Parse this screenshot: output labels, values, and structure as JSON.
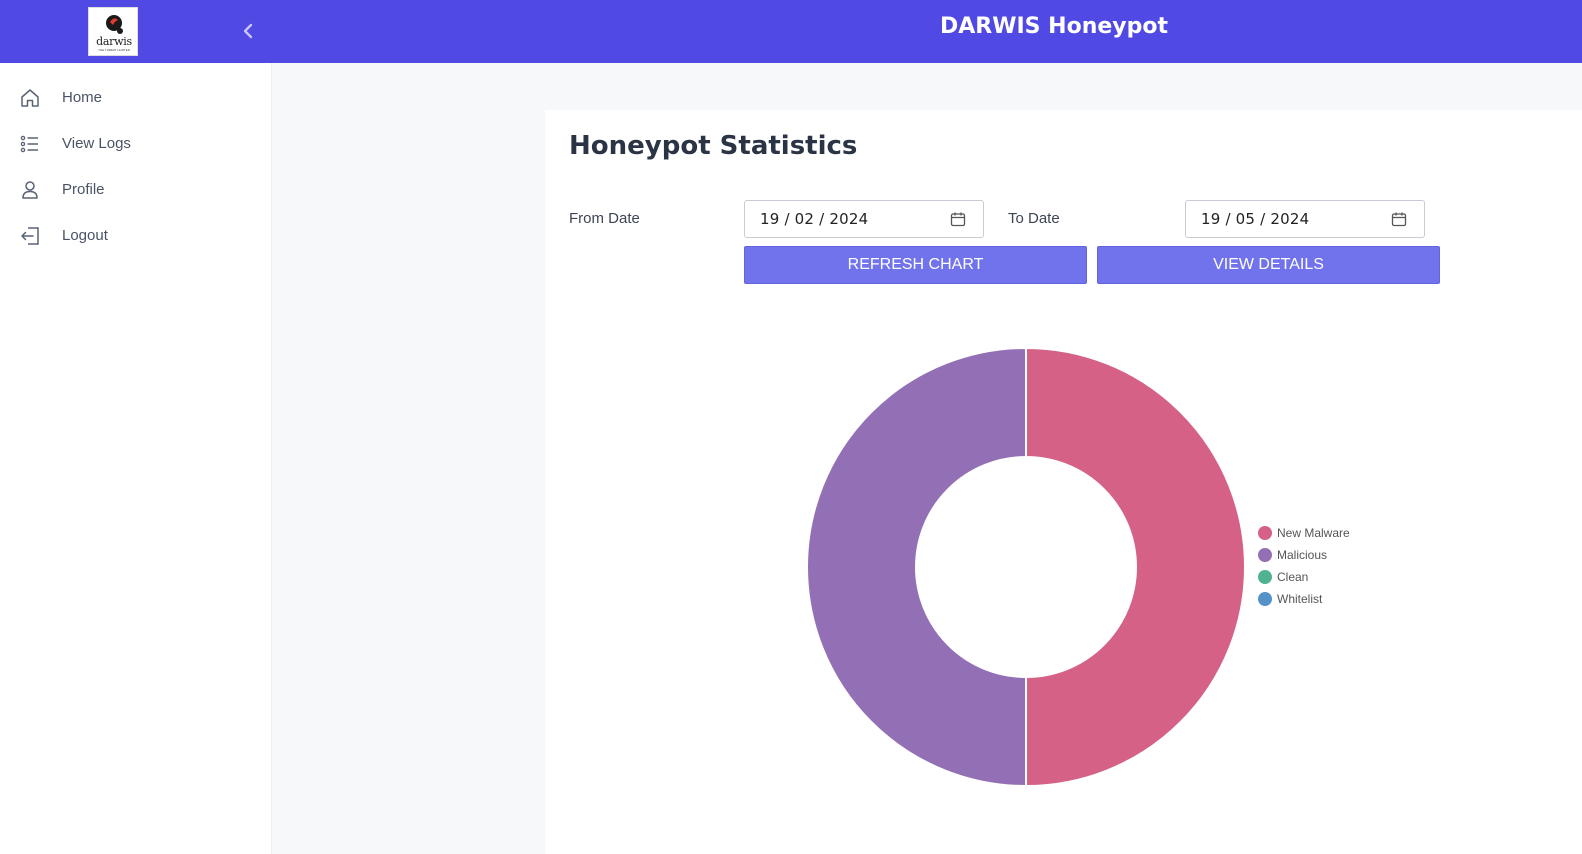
{
  "header": {
    "logo_text": "darwis",
    "logo_subtext": "THE THREAT HUNTER",
    "title": "DARWIS Honeypot",
    "brand_color": "#5149e4"
  },
  "sidebar": {
    "items": [
      {
        "label": "Home",
        "icon": "home-icon"
      },
      {
        "label": "View Logs",
        "icon": "list-icon"
      },
      {
        "label": "Profile",
        "icon": "user-icon"
      },
      {
        "label": "Logout",
        "icon": "logout-icon"
      }
    ]
  },
  "main": {
    "title": "Honeypot Statistics",
    "from_date_label": "From Date",
    "from_date_value": "19 / 02 / 2024",
    "to_date_label": "To Date",
    "to_date_value": "19 / 05 / 2024",
    "refresh_button": "REFRESH CHART",
    "details_button": "VIEW DETAILS"
  },
  "chart_data": {
    "type": "doughnut",
    "categories": [
      "New Malware",
      "Malicious",
      "Clean",
      "Whitelist"
    ],
    "values": [
      50,
      50,
      0,
      0
    ],
    "colors": [
      "#d56187",
      "#9370b6",
      "#4fb393",
      "#5592c7"
    ],
    "legend_position": "right"
  }
}
